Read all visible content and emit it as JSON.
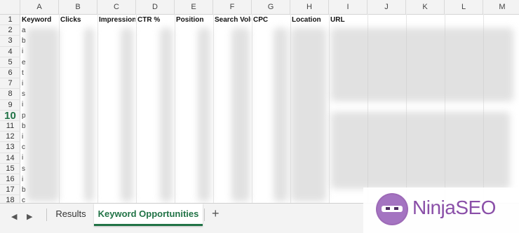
{
  "columns": [
    {
      "letter": "A",
      "header": "Keyword"
    },
    {
      "letter": "B",
      "header": "Clicks"
    },
    {
      "letter": "C",
      "header": "Impressions"
    },
    {
      "letter": "D",
      "header": "CTR %"
    },
    {
      "letter": "E",
      "header": "Position"
    },
    {
      "letter": "F",
      "header": "Search Volu"
    },
    {
      "letter": "G",
      "header": "CPC"
    },
    {
      "letter": "H",
      "header": "Location"
    },
    {
      "letter": "I",
      "header": "URL"
    },
    {
      "letter": "J",
      "header": ""
    },
    {
      "letter": "K",
      "header": ""
    },
    {
      "letter": "L",
      "header": ""
    },
    {
      "letter": "M",
      "header": ""
    }
  ],
  "rows": [
    "1",
    "2",
    "3",
    "4",
    "5",
    "6",
    "7",
    "8",
    "9",
    "10",
    "11",
    "12",
    "13",
    "14",
    "15",
    "16",
    "17",
    "18"
  ],
  "active_row": "10",
  "first_chars": [
    "a",
    "b",
    "i",
    "e",
    "t",
    "i",
    "s",
    "i",
    "p",
    "b",
    "i",
    "c",
    "i",
    "s",
    "i",
    "b",
    "c"
  ],
  "sheet_tabs": {
    "prev_icon": "◀",
    "next_icon": "▶",
    "tab1": "Results",
    "tab2": "Keyword Opportunities",
    "add": "+"
  },
  "logo": {
    "ninja": "Ninja",
    "seo": "SEO"
  },
  "accent_color": "#217346"
}
